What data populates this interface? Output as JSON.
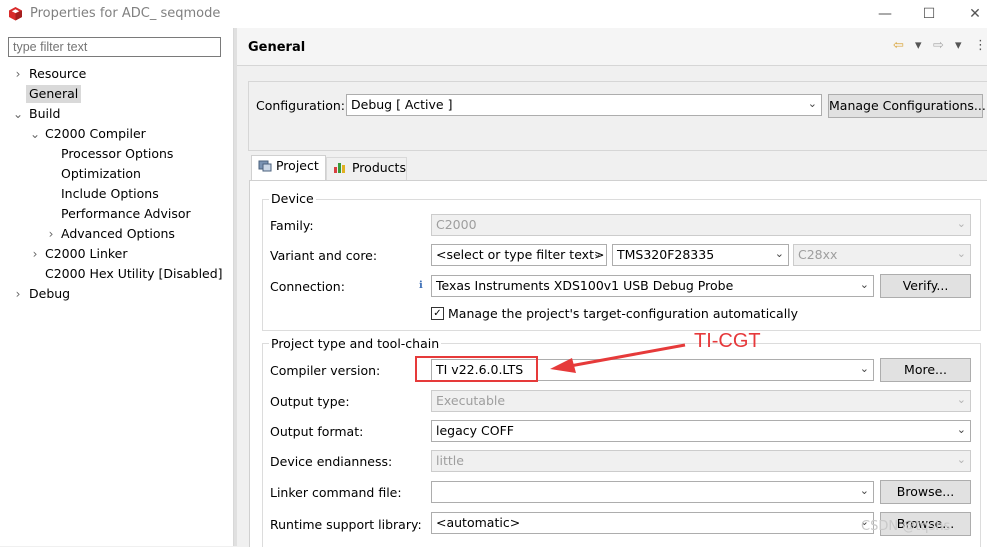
{
  "window": {
    "title": "Properties for ADC_ seqmode",
    "minimize": "—",
    "maximize": "☐",
    "close": "✕"
  },
  "sidebar": {
    "filter_placeholder": "type filter text",
    "items": [
      {
        "label": "Resource",
        "expander": "›"
      },
      {
        "label": "General",
        "selected": true
      },
      {
        "label": "Build",
        "expander": "⌄"
      },
      {
        "label": "C2000 Compiler",
        "expander": "⌄"
      },
      {
        "label": "Processor Options"
      },
      {
        "label": "Optimization"
      },
      {
        "label": "Include Options"
      },
      {
        "label": "Performance Advisor"
      },
      {
        "label": "Advanced Options",
        "expander": "›"
      },
      {
        "label": "C2000 Linker",
        "expander": "›"
      },
      {
        "label": "C2000 Hex Utility  [Disabled]"
      },
      {
        "label": "Debug",
        "expander": "›"
      }
    ]
  },
  "header": {
    "title": "General",
    "back_icon": "⇦",
    "dropdown_icon": "▾",
    "forward_icon": "⇨",
    "menu_icon": "⋮"
  },
  "config": {
    "label": "Configuration:",
    "value": "Debug  [ Active ]",
    "manage_button": "Manage Configurations..."
  },
  "tabs": [
    {
      "label": "Project",
      "active": true
    },
    {
      "label": "Products",
      "active": false
    }
  ],
  "device": {
    "title": "Device",
    "family_label": "Family:",
    "family_value": "C2000",
    "variant_label": "Variant and core:",
    "variant_filter": "<select or type filter text>",
    "variant_value": "TMS320F28335",
    "core_value": "C28xx",
    "connection_label": "Connection:",
    "connection_value": "Texas Instruments XDS100v1 USB Debug Probe",
    "verify_button": "Verify...",
    "manage_checkbox_label": "Manage the project's target-configuration automatically",
    "manage_checked": true
  },
  "toolchain": {
    "title": "Project type and tool-chain",
    "compiler_label": "Compiler version:",
    "compiler_value": "TI v22.6.0.LTS",
    "more_button": "More...",
    "output_type_label": "Output type:",
    "output_type_value": "Executable",
    "output_format_label": "Output format:",
    "output_format_value": "legacy COFF",
    "endianness_label": "Device endianness:",
    "endianness_value": "little",
    "linker_label": "Linker command file:",
    "linker_value": "",
    "browse_button": "Browse...",
    "runtime_label": "Runtime support library:",
    "runtime_value": "<automatic>",
    "browse_button2": "Browse..."
  },
  "annotation": {
    "text": "TI-CGT",
    "color": "#e6393b"
  },
  "watermark": "CSDN @tqshs"
}
